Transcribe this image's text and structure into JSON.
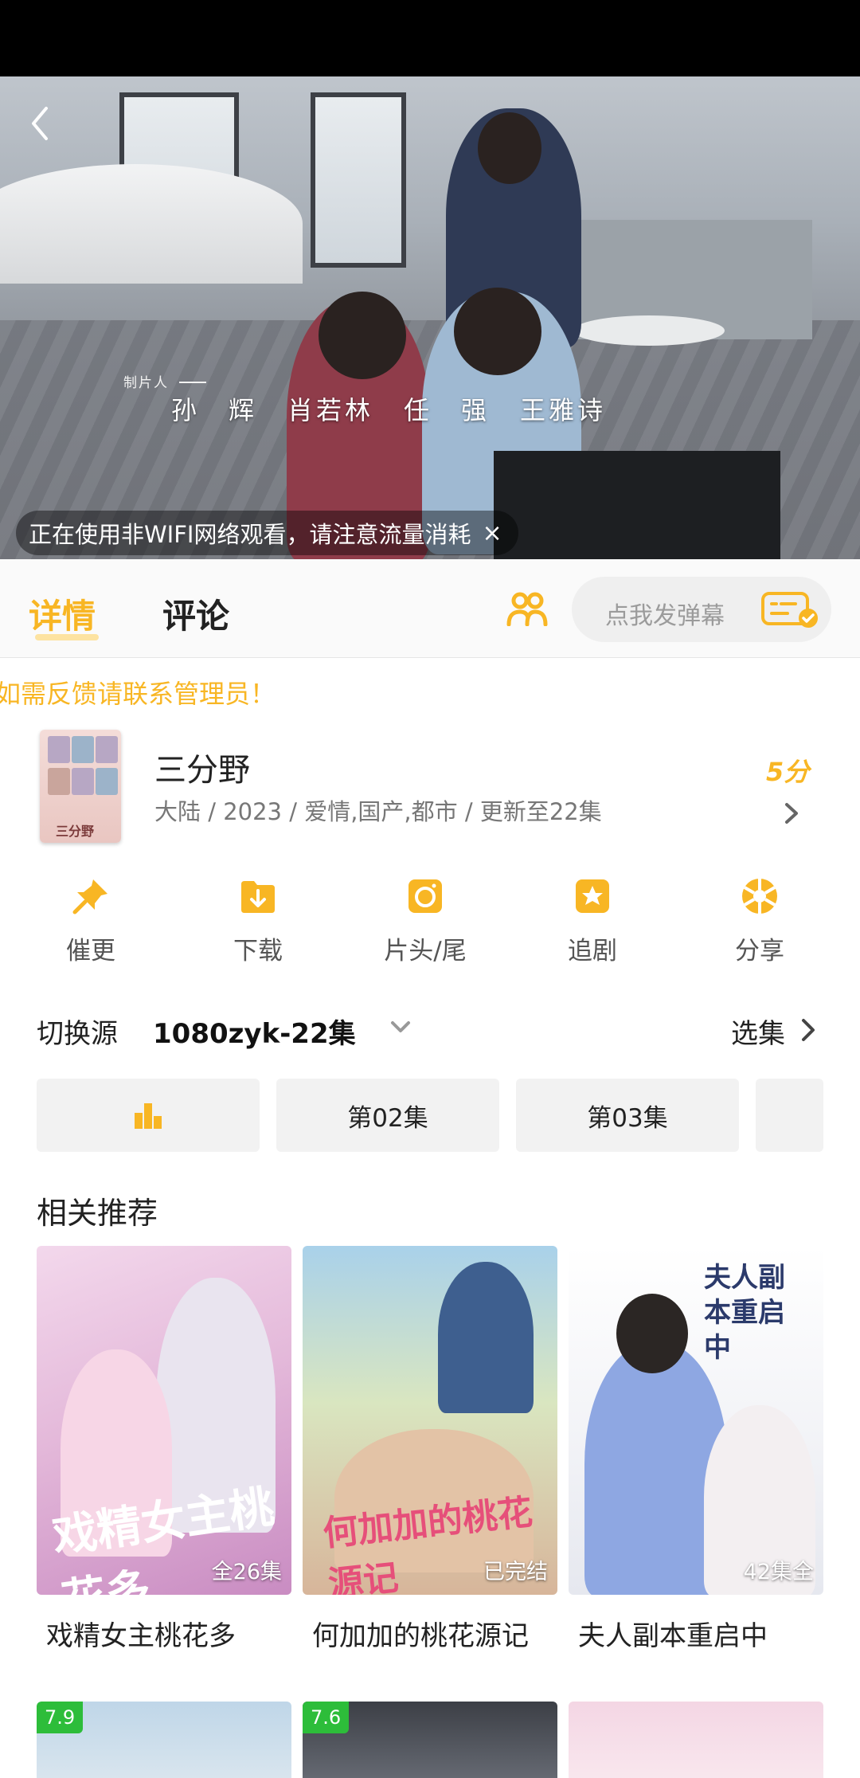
{
  "player": {
    "credits_label": "制片人",
    "credits_names": [
      "孙　辉",
      "肖若林",
      "任　强",
      "王雅诗"
    ],
    "wifi_warning": "正在使用非WIFI网络观看，请注意流量消耗",
    "close_symbol": "×"
  },
  "tabs": {
    "details": "详情",
    "comments": "评论"
  },
  "danmu": {
    "placeholder": "点我发弹幕"
  },
  "notice": "如需反馈请联系管理员！",
  "show": {
    "title": "三分野",
    "meta": "大陆 / 2023 / 爱情,国产,都市 / 更新至22集",
    "score": "5分",
    "poster_text": "三分野"
  },
  "actions": [
    "催更",
    "下载",
    "片头/尾",
    "追剧",
    "分享"
  ],
  "source": {
    "label": "切换源",
    "value": "1080zyk-22集",
    "select_label": "选集"
  },
  "episodes": [
    "第02集",
    "第03集"
  ],
  "recommend": {
    "title": "相关推荐",
    "items": [
      {
        "name": "戏精女主桃花多",
        "badge": "全26集",
        "poster_text": "戏精女主桃花多"
      },
      {
        "name": "何加加的桃花源记",
        "badge": "已完结",
        "poster_text": "何加加的桃花源记"
      },
      {
        "name": "夫人副本重启中",
        "badge": "42集全",
        "poster_text": "夫人副本重启中"
      }
    ],
    "row2_ratings": [
      "7.9",
      "7.6"
    ]
  },
  "colors": {
    "accent": "#f8b624",
    "rating_green": "#2dbd3a"
  }
}
